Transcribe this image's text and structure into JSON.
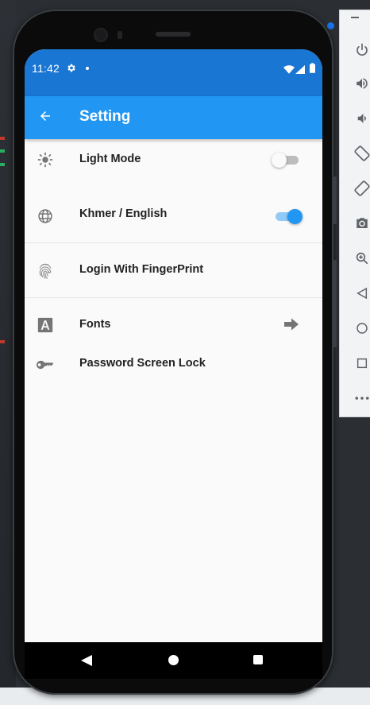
{
  "status_bar": {
    "time": "11:42",
    "icons": [
      "gear-icon",
      "notification-dot-icon",
      "wifi-icon",
      "signal-icon",
      "battery-icon"
    ]
  },
  "app_bar": {
    "title": "Setting",
    "back_icon": "arrow-back-icon"
  },
  "settings": {
    "items": [
      {
        "label": "Light Mode",
        "icon": "sun-icon",
        "control": "switch",
        "on": false
      },
      {
        "label": "Khmer / English",
        "icon": "globe-icon",
        "control": "switch",
        "on": true
      },
      {
        "label": "Login With FingerPrint",
        "icon": "fingerprint-icon",
        "control": "none"
      },
      {
        "label": "Fonts",
        "icon": "font-icon",
        "control": "arrow"
      },
      {
        "label": "Password Screen Lock",
        "icon": "key-icon",
        "control": "none"
      }
    ]
  },
  "colors": {
    "status_bar": "#1976d2",
    "app_bar": "#2196f3",
    "switch_on_track": "#90caf9",
    "switch_on_thumb": "#2196f3",
    "switch_off_track": "#bdbdbd",
    "switch_off_thumb": "#fafafa",
    "icon_gray": "#757575"
  },
  "emulator_toolbar": {
    "buttons": [
      "power-icon",
      "volume-up-icon",
      "volume-down-icon",
      "rotate-left-icon",
      "rotate-right-icon",
      "camera-icon",
      "zoom-icon",
      "back-triangle-icon",
      "home-circle-icon",
      "overview-square-icon",
      "more-icon"
    ]
  }
}
